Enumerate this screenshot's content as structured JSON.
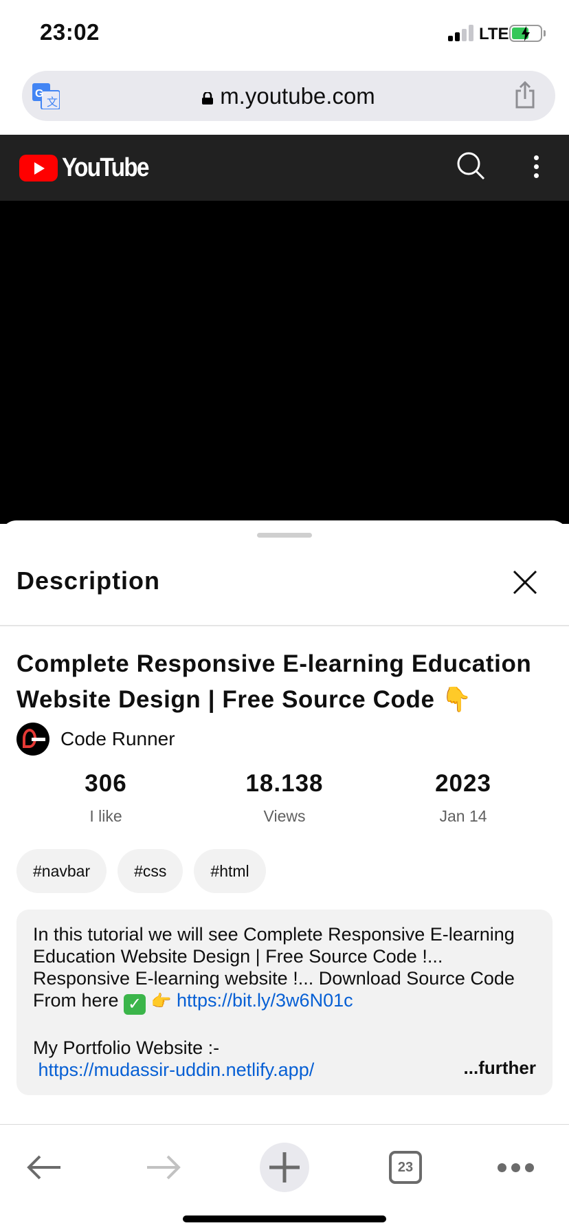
{
  "status_bar": {
    "time": "23:02",
    "network": "LTE"
  },
  "browser": {
    "url": "m.youtube.com",
    "tab_count": "23"
  },
  "youtube": {
    "logo_text": "YouTube"
  },
  "description_sheet": {
    "header": "Description",
    "video_title": "Complete Responsive E-learning Education Website Design | Free Source Code 👇",
    "channel_name": "Code Runner",
    "stats": [
      {
        "value": "306",
        "label": "I like"
      },
      {
        "value": "18.138",
        "label": "Views"
      },
      {
        "value": "2023",
        "label": "Jan 14"
      }
    ],
    "tags": [
      "#navbar",
      "#css",
      "#html"
    ],
    "description": {
      "line1": "In this tutorial we will see Complete Responsive E-learning",
      "line2": "Education Website Design | Free Source Code !...",
      "line3": "Responsive E-learning website !... Download Source Code",
      "line4_prefix": "From here",
      "line4_link": "https://bit.ly/3w6N01c",
      "line5": "My Portfolio Website :-",
      "line6_link": "https://mudassir-uddin.netlify.app/",
      "more": "...further"
    }
  },
  "icons": {
    "translate": "translate-icon",
    "lock": "lock-icon",
    "share": "share-icon",
    "search": "search-icon",
    "more": "more-vertical-icon",
    "close": "close-icon",
    "back": "back-arrow-icon",
    "forward": "forward-arrow-icon",
    "new_tab": "plus-icon",
    "menu": "more-horizontal-icon"
  },
  "colors": {
    "youtube_red": "#ff0000",
    "header_bg": "#212121",
    "link": "#065fd4"
  }
}
